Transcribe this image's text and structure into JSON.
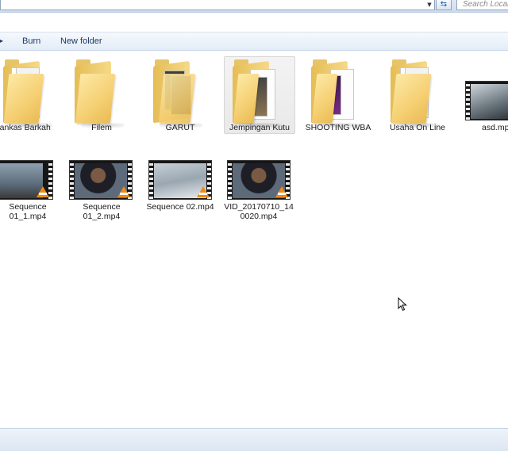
{
  "address_bar": {
    "search_placeholder": "Search Local Disk"
  },
  "toolbar": {
    "burn_label": "Burn",
    "new_folder_label": "New folder"
  },
  "folders": [
    {
      "name": "Berkas-berkas Barkah",
      "label": "rankas Barkah",
      "selected": false
    },
    {
      "name": "Filem",
      "label": "Filem",
      "selected": false
    },
    {
      "name": "GARUT",
      "label": "GARUT",
      "selected": false
    },
    {
      "name": "Jempingan Kutu",
      "label": "Jempingan Kutu",
      "selected": true
    },
    {
      "name": "SHOOTING WBA",
      "label": "SHOOTING WBA",
      "selected": false
    },
    {
      "name": "Usaha On Line",
      "label": "Usaha On Line",
      "selected": false
    }
  ],
  "files": [
    {
      "label": "asd.mp",
      "type": "video"
    },
    {
      "label_line1": "Sequence",
      "label_line2": "01_1.mp4",
      "type": "video"
    },
    {
      "label_line1": "Sequence",
      "label_line2": "01_2.mp4",
      "type": "video"
    },
    {
      "label_line1": "Sequence 02.mp4",
      "label_line2": "",
      "type": "video"
    },
    {
      "label_line1": "VID_20170710_14",
      "label_line2": "0020.mp4",
      "type": "video"
    }
  ],
  "icons": {
    "folder": "folder-icon",
    "video": "video-file-icon",
    "vlc": "vlc-cone-icon",
    "refresh": "refresh-icon",
    "cursor": "mouse-cursor-icon"
  },
  "colors": {
    "folder": "#f5cf72",
    "selection": "#e9e9e9",
    "vlc_orange": "#f08a12",
    "toolbar_text": "#1e3966"
  }
}
